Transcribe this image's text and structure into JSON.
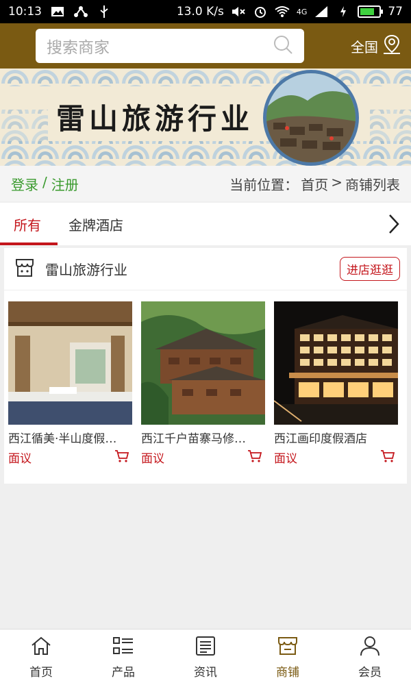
{
  "status_bar": {
    "time": "10:13",
    "speed": "13.0 K/s",
    "network": "4G",
    "battery": "77",
    "battery_level": 0.77
  },
  "header": {
    "search_placeholder": "搜索商家",
    "region": "全国"
  },
  "banner": {
    "title": "雷山旅游行业"
  },
  "breadcrumb": {
    "login": "登录",
    "separator": "/",
    "register": "注册",
    "position_label": "当前位置：",
    "home": "首页",
    "arrow": ">",
    "current": "商铺列表"
  },
  "tabs": [
    {
      "label": "所有",
      "active": true
    },
    {
      "label": "金牌酒店",
      "active": false
    }
  ],
  "shop": {
    "name": "雷山旅游行业",
    "visit_label": "进店逛逛",
    "products": [
      {
        "name": "西江循美·半山度假…",
        "price": "面议"
      },
      {
        "name": "西江千户苗寨马修…",
        "price": "面议"
      },
      {
        "name": "西江画印度假酒店",
        "price": "面议"
      }
    ]
  },
  "bottom_nav": [
    {
      "label": "首页",
      "icon": "home-icon",
      "active": false
    },
    {
      "label": "产品",
      "icon": "list-icon",
      "active": false
    },
    {
      "label": "资讯",
      "icon": "news-icon",
      "active": false
    },
    {
      "label": "商铺",
      "icon": "store-icon",
      "active": true
    },
    {
      "label": "会员",
      "icon": "user-icon",
      "active": false
    }
  ],
  "colors": {
    "brand": "#7a5a12",
    "accent": "#c4161c",
    "link_green": "#3a9a2e"
  }
}
